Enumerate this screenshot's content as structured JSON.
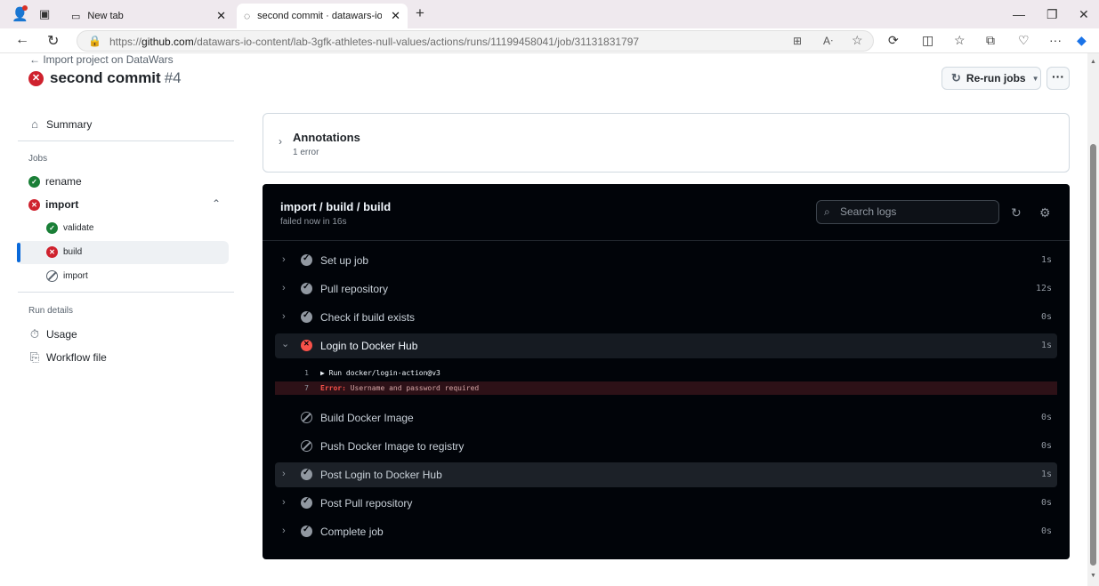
{
  "browser": {
    "tabs": [
      {
        "title": "New tab"
      },
      {
        "title": "second commit · datawars-io-con"
      }
    ],
    "url_prefix": "https://",
    "url_host": "github.com",
    "url_path": "/datawars-io-content/lab-3gfk-athletes-null-values/actions/runs/11199458041/job/31131831797"
  },
  "header": {
    "back_link": "← Import project on DataWars",
    "run_title": "second commit",
    "run_number": "#4",
    "rerun_label": "Re-run jobs"
  },
  "sidebar": {
    "summary_label": "Summary",
    "jobs_heading": "Jobs",
    "jobs": [
      {
        "label": "rename",
        "status": "success"
      },
      {
        "label": "import",
        "status": "failure"
      }
    ],
    "import_children": [
      {
        "label": "validate",
        "status": "success"
      },
      {
        "label": "build",
        "status": "failure"
      },
      {
        "label": "import",
        "status": "skipped"
      }
    ],
    "run_details_heading": "Run details",
    "usage_label": "Usage",
    "workflow_file_label": "Workflow file"
  },
  "annotations": {
    "title": "Annotations",
    "subtitle": "1 error"
  },
  "log": {
    "job_title": "import / build / build",
    "job_subtitle": "failed now in 16s",
    "search_placeholder": "Search logs",
    "steps": [
      {
        "name": "Set up job",
        "status": "success",
        "duration": "1s"
      },
      {
        "name": "Pull repository",
        "status": "success",
        "duration": "12s"
      },
      {
        "name": "Check if build exists",
        "status": "success",
        "duration": "0s"
      },
      {
        "name": "Login to Docker Hub",
        "status": "failure",
        "duration": "1s"
      },
      {
        "name": "Build Docker Image",
        "status": "skipped",
        "duration": "0s"
      },
      {
        "name": "Push Docker Image to registry",
        "status": "skipped",
        "duration": "0s"
      },
      {
        "name": "Post Login to Docker Hub",
        "status": "success",
        "duration": "1s"
      },
      {
        "name": "Post Pull repository",
        "status": "success",
        "duration": "0s"
      },
      {
        "name": "Complete job",
        "status": "success",
        "duration": "0s"
      }
    ],
    "log_lines": [
      {
        "num": "1",
        "text": "▶ Run docker/login-action@v3"
      },
      {
        "num": "7",
        "label": "Error:",
        "text": " Username and password required"
      }
    ]
  },
  "colors": {
    "failure": "#cf222e",
    "success": "#1a7f37",
    "accent": "#0969da",
    "log_bg": "#010409"
  }
}
